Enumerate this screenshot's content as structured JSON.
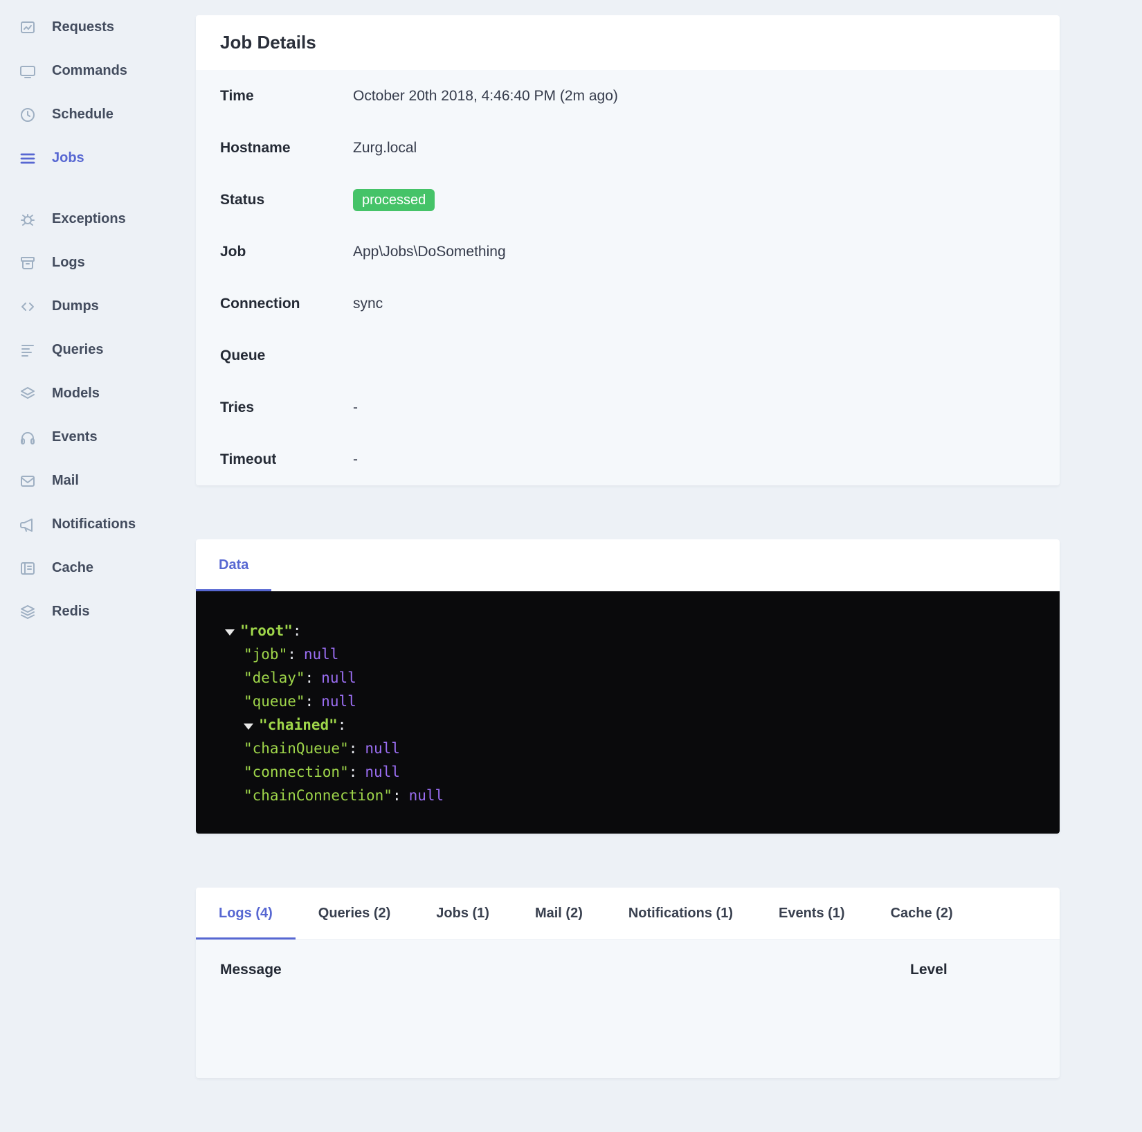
{
  "colors": {
    "accent": "#5767d2",
    "badge_bg": "#45c368",
    "badge_text": "#ffffff",
    "code_bg": "#0a0a0c",
    "json_key_green": "#9fd64a",
    "json_null_purple": "#9b6ef3",
    "page_bg": "#edf1f6"
  },
  "sidebar": {
    "items": [
      {
        "label": "Requests",
        "icon": "requests-icon",
        "active": false
      },
      {
        "label": "Commands",
        "icon": "commands-icon",
        "active": false
      },
      {
        "label": "Schedule",
        "icon": "schedule-icon",
        "active": false
      },
      {
        "label": "Jobs",
        "icon": "jobs-icon",
        "active": true
      },
      {
        "label": "Exceptions",
        "icon": "exceptions-icon",
        "active": false
      },
      {
        "label": "Logs",
        "icon": "logs-icon",
        "active": false
      },
      {
        "label": "Dumps",
        "icon": "dumps-icon",
        "active": false
      },
      {
        "label": "Queries",
        "icon": "queries-icon",
        "active": false
      },
      {
        "label": "Models",
        "icon": "models-icon",
        "active": false
      },
      {
        "label": "Events",
        "icon": "events-icon",
        "active": false
      },
      {
        "label": "Mail",
        "icon": "mail-icon",
        "active": false
      },
      {
        "label": "Notifications",
        "icon": "notifications-icon",
        "active": false
      },
      {
        "label": "Cache",
        "icon": "cache-icon",
        "active": false
      },
      {
        "label": "Redis",
        "icon": "redis-icon",
        "active": false
      }
    ]
  },
  "job_details": {
    "title": "Job Details",
    "rows": [
      {
        "label": "Time",
        "value": "October 20th 2018, 4:46:40 PM (2m ago)"
      },
      {
        "label": "Hostname",
        "value": "Zurg.local"
      },
      {
        "label": "Status",
        "value": "processed"
      },
      {
        "label": "Job",
        "value": "App\\Jobs\\DoSomething"
      },
      {
        "label": "Connection",
        "value": "sync"
      },
      {
        "label": "Queue",
        "value": ""
      },
      {
        "label": "Tries",
        "value": "-"
      },
      {
        "label": "Timeout",
        "value": "-"
      }
    ]
  },
  "data_panel": {
    "tab_label": "Data",
    "lines": [
      {
        "key": "\"root\"",
        "punct": ":",
        "value": ""
      },
      {
        "key": "\"job\"",
        "punct": ":",
        "value": "null"
      },
      {
        "key": "\"delay\"",
        "punct": ":",
        "value": "null"
      },
      {
        "key": "\"queue\"",
        "punct": ":",
        "value": "null"
      },
      {
        "key": "\"chained\"",
        "punct": ":",
        "value": ""
      },
      {
        "key": "\"chainQueue\"",
        "punct": ":",
        "value": "null"
      },
      {
        "key": "\"connection\"",
        "punct": ":",
        "value": "null"
      },
      {
        "key": "\"chainConnection\"",
        "punct": ":",
        "value": "null"
      }
    ]
  },
  "activity": {
    "tabs": [
      {
        "label": "Logs (4)",
        "active": true
      },
      {
        "label": "Queries (2)",
        "active": false
      },
      {
        "label": "Jobs (1)",
        "active": false
      },
      {
        "label": "Mail (2)",
        "active": false
      },
      {
        "label": "Notifications (1)",
        "active": false
      },
      {
        "label": "Events (1)",
        "active": false
      },
      {
        "label": "Cache (2)",
        "active": false
      }
    ],
    "table_headers": [
      "Message",
      "Level"
    ]
  }
}
